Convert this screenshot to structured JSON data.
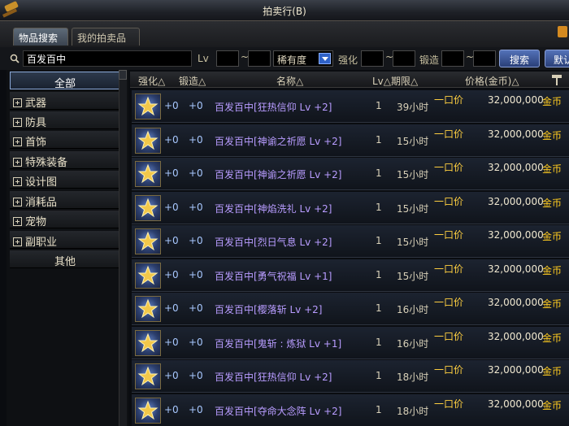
{
  "window": {
    "title": "拍卖行(B)"
  },
  "tabs": {
    "search": "物品搜索",
    "mine": "我的拍卖品"
  },
  "search": {
    "query": "百发百中",
    "lv_label": "Lv",
    "tilde": "~",
    "rarity_value": "稀有度",
    "enhance_label": "强化",
    "forge_label": "锻造",
    "search_button": "搜索",
    "default_button": "默认"
  },
  "categories": [
    {
      "label": "全部"
    },
    {
      "label": "武器"
    },
    {
      "label": "防具"
    },
    {
      "label": "首饰"
    },
    {
      "label": "特殊装备"
    },
    {
      "label": "设计图"
    },
    {
      "label": "消耗品"
    },
    {
      "label": "宠物"
    },
    {
      "label": "副职业"
    },
    {
      "label": "其他"
    }
  ],
  "columns": {
    "enhance": "强化△",
    "forge": "锻造△",
    "name": "名称△",
    "lv_period": "Lv△期限△",
    "price": "价格(金币)△"
  },
  "rows": [
    {
      "enhance": "+0",
      "forge": "+0",
      "name": "百发百中[狂热信仰 Lv +2]",
      "lv": "1",
      "time": "39小时",
      "buyout": "一口价",
      "price": "32,000,000",
      "currency": "金币"
    },
    {
      "enhance": "+0",
      "forge": "+0",
      "name": "百发百中[神谕之祈愿 Lv +2]",
      "lv": "1",
      "time": "15小时",
      "buyout": "一口价",
      "price": "32,000,000",
      "currency": "金币"
    },
    {
      "enhance": "+0",
      "forge": "+0",
      "name": "百发百中[神谕之祈愿 Lv +2]",
      "lv": "1",
      "time": "15小时",
      "buyout": "一口价",
      "price": "32,000,000",
      "currency": "金币"
    },
    {
      "enhance": "+0",
      "forge": "+0",
      "name": "百发百中[神焰洗礼 Lv +2]",
      "lv": "1",
      "time": "15小时",
      "buyout": "一口价",
      "price": "32,000,000",
      "currency": "金币"
    },
    {
      "enhance": "+0",
      "forge": "+0",
      "name": "百发百中[烈日气息 Lv +2]",
      "lv": "1",
      "time": "15小时",
      "buyout": "一口价",
      "price": "32,000,000",
      "currency": "金币"
    },
    {
      "enhance": "+0",
      "forge": "+0",
      "name": "百发百中[勇气祝福 Lv +1]",
      "lv": "1",
      "time": "15小时",
      "buyout": "一口价",
      "price": "32,000,000",
      "currency": "金币"
    },
    {
      "enhance": "+0",
      "forge": "+0",
      "name": "百发百中[樱落斩 Lv +2]",
      "lv": "1",
      "time": "16小时",
      "buyout": "一口价",
      "price": "32,000,000",
      "currency": "金币"
    },
    {
      "enhance": "+0",
      "forge": "+0",
      "name": "百发百中[鬼斩 : 炼狱 Lv +1]",
      "lv": "1",
      "time": "16小时",
      "buyout": "一口价",
      "price": "32,000,000",
      "currency": "金币"
    },
    {
      "enhance": "+0",
      "forge": "+0",
      "name": "百发百中[狂热信仰 Lv +2]",
      "lv": "1",
      "time": "18小时",
      "buyout": "一口价",
      "price": "32,000,000",
      "currency": "金币"
    },
    {
      "enhance": "+0",
      "forge": "+0",
      "name": "百发百中[夺命大念阵 Lv +2]",
      "lv": "1",
      "time": "18小时",
      "buyout": "一口价",
      "price": "32,000,000",
      "currency": "金币"
    }
  ]
}
